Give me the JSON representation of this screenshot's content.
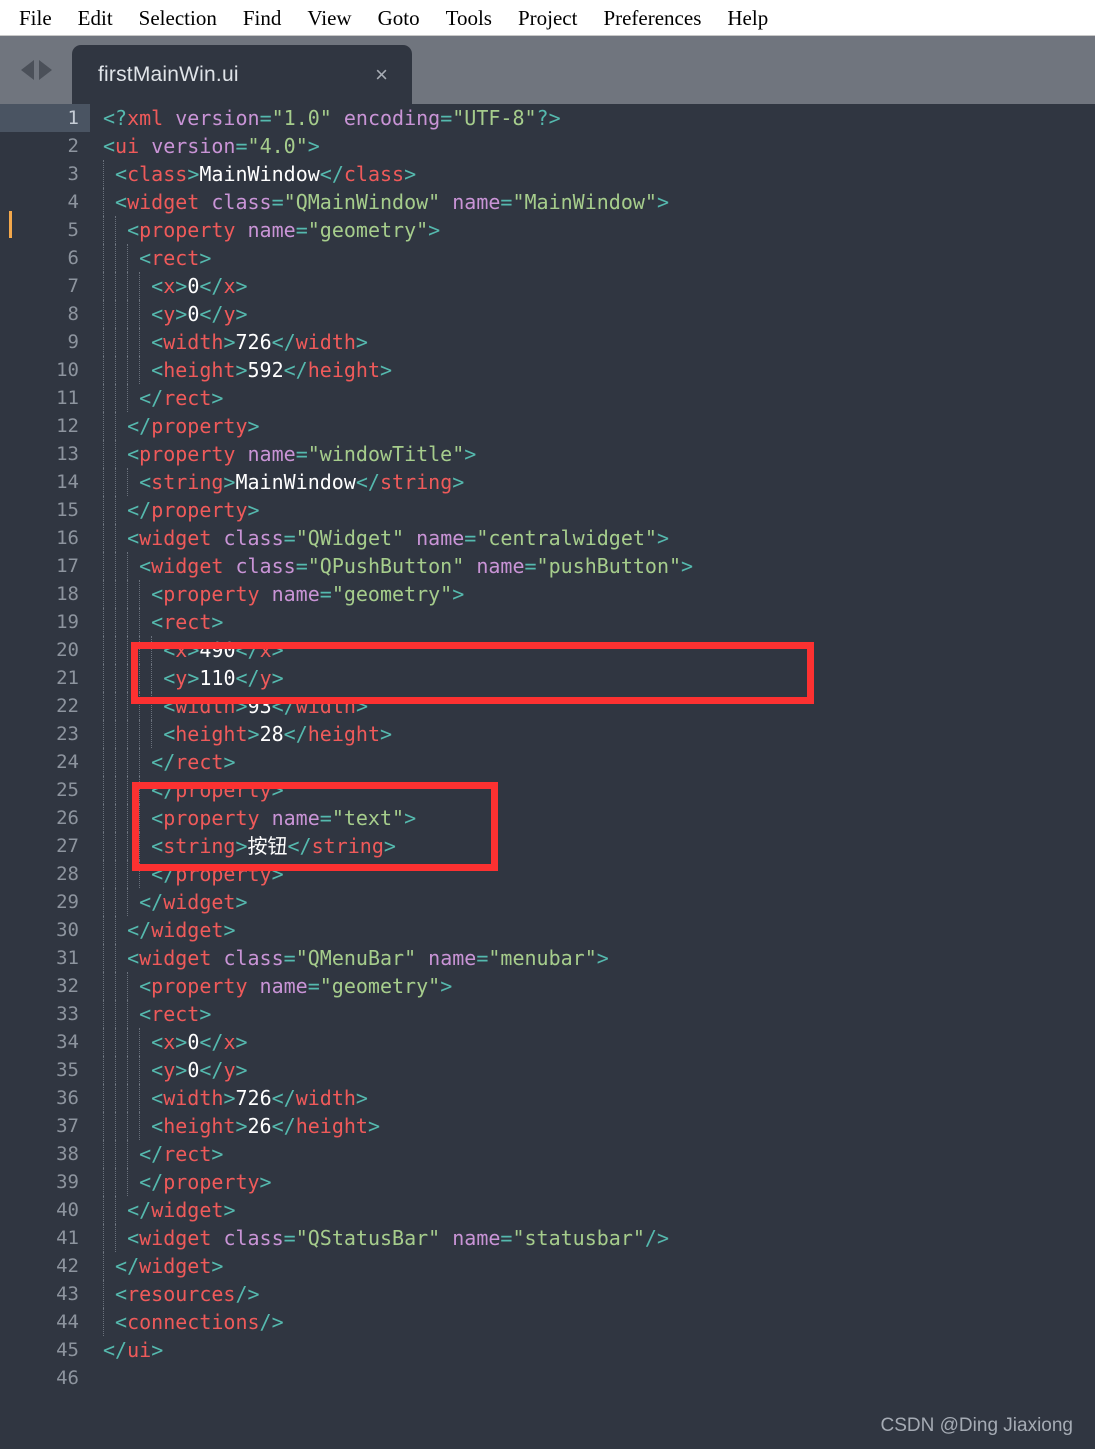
{
  "menubar": {
    "items": [
      {
        "label": "File"
      },
      {
        "label": "Edit"
      },
      {
        "label": "Selection"
      },
      {
        "label": "Find"
      },
      {
        "label": "View"
      },
      {
        "label": "Goto"
      },
      {
        "label": "Tools"
      },
      {
        "label": "Project"
      },
      {
        "label": "Preferences"
      },
      {
        "label": "Help"
      }
    ]
  },
  "tabbar": {
    "nav_back_icon": "triangle-left-icon",
    "nav_forward_icon": "triangle-right-icon",
    "active_tab": {
      "label": "firstMainWin.ui",
      "close_glyph": "×"
    }
  },
  "editor": {
    "active_line": 1,
    "caret_color": "#f3a84b",
    "background": "#303641",
    "gutter_background_active": "#4a5462",
    "total_lines": 46,
    "line_numbers": [
      1,
      2,
      3,
      4,
      5,
      6,
      7,
      8,
      9,
      10,
      11,
      12,
      13,
      14,
      15,
      16,
      17,
      18,
      19,
      20,
      21,
      22,
      23,
      24,
      25,
      26,
      27,
      28,
      29,
      30,
      31,
      32,
      33,
      34,
      35,
      36,
      37,
      38,
      39,
      40,
      41,
      42,
      43,
      44,
      45,
      46
    ],
    "syntax_colors": {
      "punctuation": "#55b9ae",
      "tag": "#ef5a5a",
      "attribute": "#c994d6",
      "string": "#a6cd8c",
      "text": "#ffffff"
    },
    "lines": [
      {
        "n": 1,
        "indent": 0,
        "text": "<?xml version=\"1.0\" encoding=\"UTF-8\"?>"
      },
      {
        "n": 2,
        "indent": 0,
        "text": "<ui version=\"4.0\">"
      },
      {
        "n": 3,
        "indent": 1,
        "text": "<class>MainWindow</class>"
      },
      {
        "n": 4,
        "indent": 1,
        "text": "<widget class=\"QMainWindow\" name=\"MainWindow\">"
      },
      {
        "n": 5,
        "indent": 2,
        "text": "<property name=\"geometry\">"
      },
      {
        "n": 6,
        "indent": 3,
        "text": "<rect>"
      },
      {
        "n": 7,
        "indent": 4,
        "text": "<x>0</x>"
      },
      {
        "n": 8,
        "indent": 4,
        "text": "<y>0</y>"
      },
      {
        "n": 9,
        "indent": 4,
        "text": "<width>726</width>"
      },
      {
        "n": 10,
        "indent": 4,
        "text": "<height>592</height>"
      },
      {
        "n": 11,
        "indent": 3,
        "text": "</rect>"
      },
      {
        "n": 12,
        "indent": 2,
        "text": "</property>"
      },
      {
        "n": 13,
        "indent": 2,
        "text": "<property name=\"windowTitle\">"
      },
      {
        "n": 14,
        "indent": 3,
        "text": "<string>MainWindow</string>"
      },
      {
        "n": 15,
        "indent": 2,
        "text": "</property>"
      },
      {
        "n": 16,
        "indent": 2,
        "text": "<widget class=\"QWidget\" name=\"centralwidget\">"
      },
      {
        "n": 17,
        "indent": 3,
        "text": "<widget class=\"QPushButton\" name=\"pushButton\">"
      },
      {
        "n": 18,
        "indent": 4,
        "text": "<property name=\"geometry\">"
      },
      {
        "n": 19,
        "indent": 4,
        "text": "<rect>"
      },
      {
        "n": 20,
        "indent": 5,
        "text": "<x>490</x>"
      },
      {
        "n": 21,
        "indent": 5,
        "text": "<y>110</y>"
      },
      {
        "n": 22,
        "indent": 5,
        "text": "<width>93</width>"
      },
      {
        "n": 23,
        "indent": 5,
        "text": "<height>28</height>"
      },
      {
        "n": 24,
        "indent": 4,
        "text": "</rect>"
      },
      {
        "n": 25,
        "indent": 4,
        "text": "</property>"
      },
      {
        "n": 26,
        "indent": 4,
        "text": "<property name=\"text\">"
      },
      {
        "n": 27,
        "indent": 4,
        "text": "<string>按钮</string>"
      },
      {
        "n": 28,
        "indent": 4,
        "text": "</property>"
      },
      {
        "n": 29,
        "indent": 3,
        "text": "</widget>"
      },
      {
        "n": 30,
        "indent": 2,
        "text": "</widget>"
      },
      {
        "n": 31,
        "indent": 2,
        "text": "<widget class=\"QMenuBar\" name=\"menubar\">"
      },
      {
        "n": 32,
        "indent": 3,
        "text": "<property name=\"geometry\">"
      },
      {
        "n": 33,
        "indent": 3,
        "text": "<rect>"
      },
      {
        "n": 34,
        "indent": 4,
        "text": "<x>0</x>"
      },
      {
        "n": 35,
        "indent": 4,
        "text": "<y>0</y>"
      },
      {
        "n": 36,
        "indent": 4,
        "text": "<width>726</width>"
      },
      {
        "n": 37,
        "indent": 4,
        "text": "<height>26</height>"
      },
      {
        "n": 38,
        "indent": 3,
        "text": "</rect>"
      },
      {
        "n": 39,
        "indent": 3,
        "text": "</property>"
      },
      {
        "n": 40,
        "indent": 2,
        "text": "</widget>"
      },
      {
        "n": 41,
        "indent": 2,
        "text": "<widget class=\"QStatusBar\" name=\"statusbar\"/>"
      },
      {
        "n": 42,
        "indent": 1,
        "text": "</widget>"
      },
      {
        "n": 43,
        "indent": 1,
        "text": "<resources/>"
      },
      {
        "n": 44,
        "indent": 1,
        "text": "<connections/>"
      },
      {
        "n": 45,
        "indent": 0,
        "text": "</ui>"
      },
      {
        "n": 46,
        "indent": 0,
        "text": ""
      }
    ]
  },
  "annotations": {
    "color": "#fc3131",
    "boxes": [
      {
        "name": "pushbutton-declaration",
        "covers_lines": [
          16,
          17,
          18
        ]
      },
      {
        "name": "button-size",
        "covers_lines": [
          21,
          22,
          23,
          24
        ]
      }
    ]
  },
  "watermark": {
    "text": "CSDN @Ding Jiaxiong"
  }
}
